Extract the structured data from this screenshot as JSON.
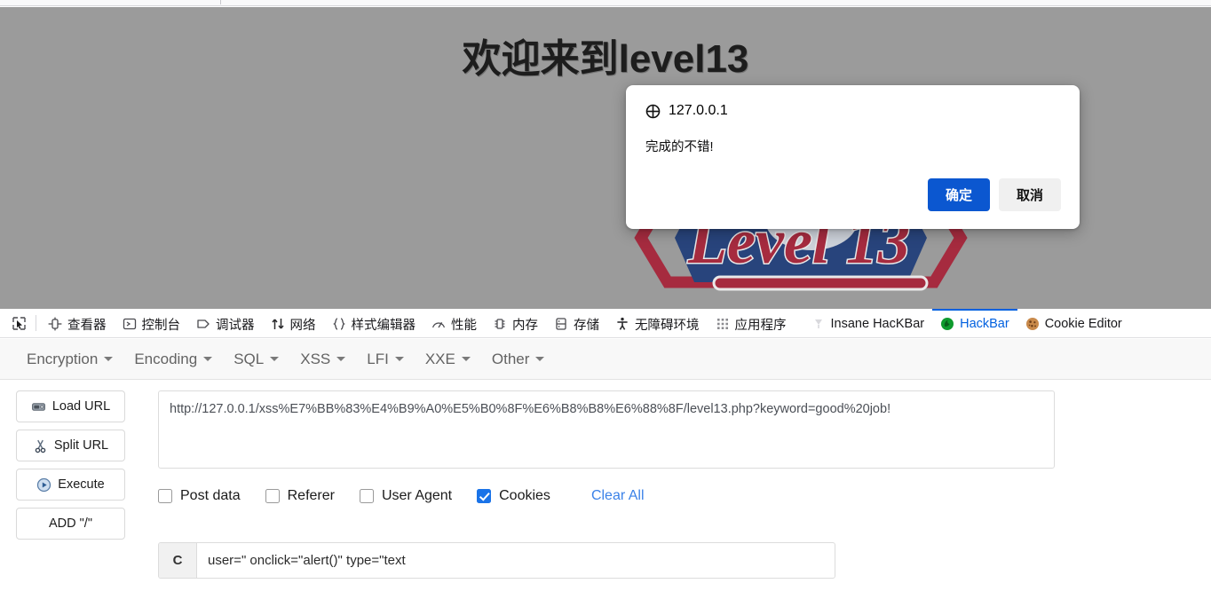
{
  "page": {
    "heading": "欢迎来到level13",
    "logo_text": "Level 13"
  },
  "dialog": {
    "origin": "127.0.0.1",
    "origin_icon": "globe-icon",
    "message": "完成的不错!",
    "confirm_label": "确定",
    "cancel_label": "取消",
    "confirm_color": "#0b57d0",
    "cancel_color": "#f0f0f0"
  },
  "devtools": {
    "picker_icon": "cursor-picker-icon",
    "accent_color": "#0060df",
    "tabs": [
      {
        "label": "查看器",
        "icon": "inspector-icon",
        "active": false
      },
      {
        "label": "控制台",
        "icon": "console-icon",
        "active": false
      },
      {
        "label": "调试器",
        "icon": "debugger-icon",
        "active": false
      },
      {
        "label": "网络",
        "icon": "network-icon",
        "active": false
      },
      {
        "label": "样式编辑器",
        "icon": "style-editor-icon",
        "active": false
      },
      {
        "label": "性能",
        "icon": "performance-icon",
        "active": false
      },
      {
        "label": "内存",
        "icon": "memory-icon",
        "active": false
      },
      {
        "label": "存储",
        "icon": "storage-icon",
        "active": false
      },
      {
        "label": "无障碍环境",
        "icon": "accessibility-icon",
        "active": false
      },
      {
        "label": "应用程序",
        "icon": "application-icon",
        "active": false
      },
      {
        "label": "Insane HacKBar",
        "icon": "insane-hackbar-icon",
        "active": false
      },
      {
        "label": "HackBar",
        "icon": "hackbar-icon",
        "active": true
      },
      {
        "label": "Cookie Editor",
        "icon": "cookie-icon",
        "active": false
      }
    ]
  },
  "hackbar": {
    "menus": [
      {
        "label": "Encryption"
      },
      {
        "label": "Encoding"
      },
      {
        "label": "SQL"
      },
      {
        "label": "XSS"
      },
      {
        "label": "LFI"
      },
      {
        "label": "XXE"
      },
      {
        "label": "Other"
      }
    ],
    "buttons": [
      {
        "label": "Load URL",
        "icon": "load-url-icon"
      },
      {
        "label": "Split URL",
        "icon": "scissors-icon"
      },
      {
        "label": "Execute",
        "icon": "play-icon"
      },
      {
        "label": "ADD \"/\"",
        "icon": "none"
      }
    ],
    "url_value": "http://127.0.0.1/xss%E7%BB%83%E4%B9%A0%E5%B0%8F%E6%B8%B8%E6%88%8F/level13.php?keyword=good%20job!",
    "url_placeholder": "",
    "options": [
      {
        "label": "Post data",
        "checked": false
      },
      {
        "label": "Referer",
        "checked": false
      },
      {
        "label": "User Agent",
        "checked": false
      },
      {
        "label": "Cookies",
        "checked": true
      }
    ],
    "clear_all_label": "Clear All",
    "clear_all_color": "#3b82e8",
    "cookie_prefix": "C",
    "cookie_value": "user=\" onclick=\"alert()\" type=\"text",
    "cookie_placeholder": ""
  }
}
